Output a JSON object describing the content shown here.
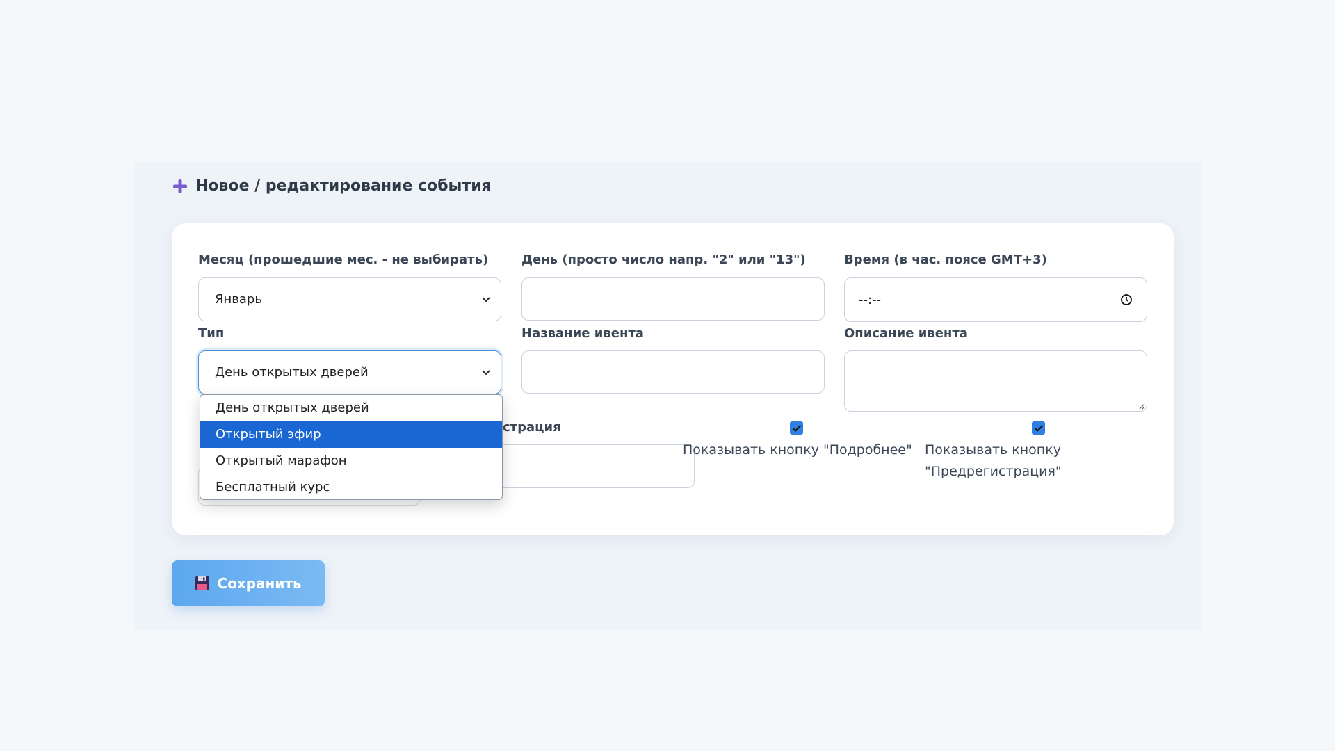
{
  "section": {
    "title": "Новое / редактирование события",
    "icon": "plus-icon"
  },
  "form": {
    "month": {
      "label": "Месяц (прошедшие мес. - не выбирать)",
      "value": "Январь"
    },
    "day": {
      "label": "День (просто число напр. \"2\" или \"13\")",
      "value": ""
    },
    "time": {
      "label": "Время (в час. поясе GMT+3)",
      "value": "--:--"
    },
    "type": {
      "label": "Тип",
      "value": "День открытых дверей",
      "options": [
        "День открытых дверей",
        "Открытый эфир",
        "Открытый марафон",
        "Бесплатный курс"
      ],
      "highlighted": "Открытый эфир"
    },
    "event_name": {
      "label": "Название ивента",
      "value": ""
    },
    "event_description": {
      "label": "Описание ивента",
      "value": ""
    },
    "registration": {
      "label_partial": "страция",
      "value": ""
    },
    "show_more_button": {
      "label": "Показывать кнопку \"Подробнее\"",
      "checked": true
    },
    "show_prereg_button": {
      "label_line1": "Показывать кнопку",
      "label_line2": "\"Предрегистрация\"",
      "checked": true
    }
  },
  "actions": {
    "save_label": "Сохранить",
    "save_icon": "floppy-disk-icon"
  },
  "colors": {
    "accent": "#2f7fe0",
    "button": "#6aaff1",
    "highlight": "#1a66d2",
    "plus": "#7a5bd0"
  }
}
